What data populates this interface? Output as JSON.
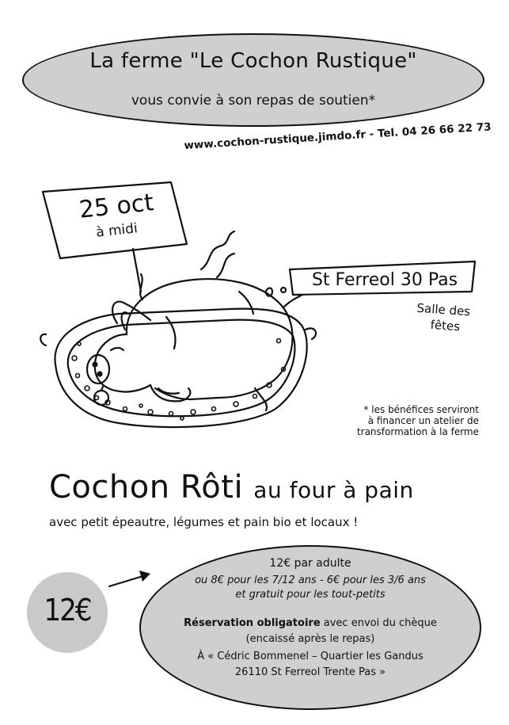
{
  "header": {
    "title": "La ferme \"Le Cochon Rustique\"",
    "subtitle": "vous convie à son repas de soutien*"
  },
  "contact": "www.cochon-rustique.jimdo.fr - Tel. 04 26 66 22 73",
  "sign_date": {
    "line1": "25 oct",
    "line2": "à midi"
  },
  "sign_place": {
    "line1": "St Ferreol 30 Pas",
    "line2": "Salle des",
    "line3": "fêtes"
  },
  "note": {
    "line1": "* les bénéfices serviront",
    "line2": "à financer un atelier de",
    "line3": "transformation à la ferme"
  },
  "main": {
    "title_big": "Cochon Rôti",
    "title_small": "au four à pain",
    "tagline": "avec petit épeautre, légumes et pain bio et locaux !"
  },
  "price_badge": "12€",
  "pricing": {
    "adult": "12€ par adulte",
    "children": "ou 8€ pour les 7/12 ans - 6€ pour les 3/6 ans",
    "toddlers": "et gratuit pour les tout-petits",
    "reservation_bold": "Réservation obligatoire",
    "reservation_rest": " avec envoi du chèque",
    "cashed": "(encaissé après le repas)",
    "address1": "À « Cédric Bommenel – Quartier les Gandus",
    "address2": "26110 St Ferreol Trente Pas »"
  },
  "icons": {
    "illustration": "roast-pig-on-platter-icon",
    "arrow": "arrow-right-icon"
  }
}
